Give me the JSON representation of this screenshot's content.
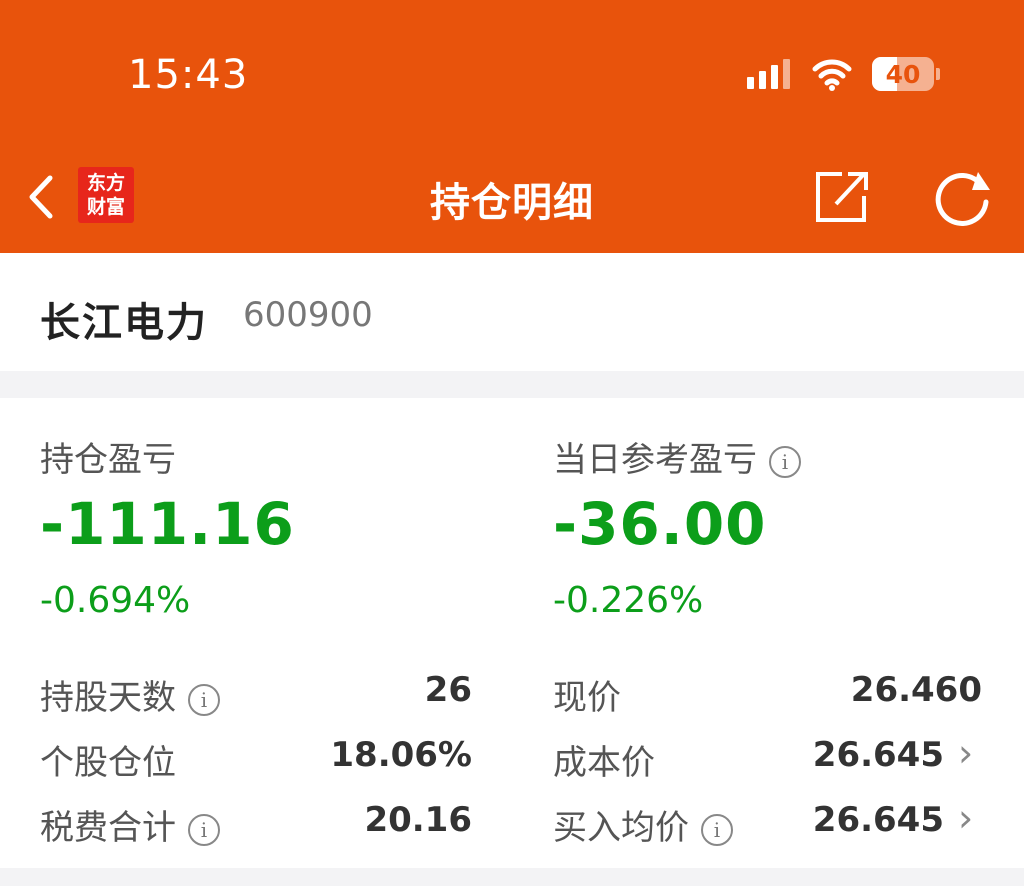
{
  "status_bar": {
    "time": "15:43",
    "battery_level": "40",
    "battery_percent": 40
  },
  "nav": {
    "logo_line1": "东方",
    "logo_line2": "财富",
    "title": "持仓明细"
  },
  "colors": {
    "header": "#e8530c",
    "loss": "#0c9e1a",
    "logo": "#e7261b"
  },
  "stock": {
    "name": "长江电力",
    "code": "600900"
  },
  "summary": {
    "position_pnl_label": "持仓盈亏",
    "position_pnl_value": "-111.16",
    "position_pnl_pct": "-0.694%",
    "daily_pnl_label": "当日参考盈亏",
    "daily_pnl_value": "-36.00",
    "daily_pnl_pct": "-0.226%"
  },
  "details": {
    "holding_days_label": "持股天数",
    "holding_days_value": "26",
    "position_ratio_label": "个股仓位",
    "position_ratio_value": "18.06%",
    "fees_label": "税费合计",
    "fees_value": "20.16",
    "current_price_label": "现价",
    "current_price_value": "26.460",
    "cost_price_label": "成本价",
    "cost_price_value": "26.645",
    "avg_buy_label": "买入均价",
    "avg_buy_value": "26.645"
  },
  "icons": {
    "info": "i",
    "chevron": "›"
  }
}
